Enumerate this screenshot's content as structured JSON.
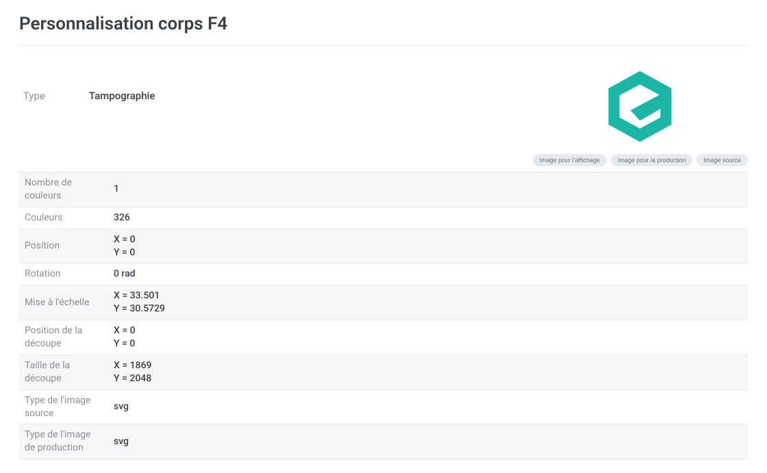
{
  "title": "Personnalisation corps F4",
  "top": {
    "type_label": "Type",
    "type_value": "Tampographie"
  },
  "pills": {
    "display": "Image pour l'affichage",
    "production": "Image pour la production",
    "source": "Image source"
  },
  "rows": [
    {
      "label": "Nombre de couleurs",
      "value": "1",
      "shade": true
    },
    {
      "label": "Couleurs",
      "value": "326",
      "shade": false
    },
    {
      "label": "Position",
      "lines": [
        "X = 0",
        "Y = 0"
      ],
      "shade": true
    },
    {
      "label": "Rotation",
      "value": "0 rad",
      "shade": false
    },
    {
      "label": "Mise à l'échelle",
      "lines": [
        "X = 33.501",
        "Y = 30.5729"
      ],
      "shade": true
    },
    {
      "label": "Position de la découpe",
      "lines": [
        "X = 0",
        "Y = 0"
      ],
      "shade": false
    },
    {
      "label": "Taille de la découpe",
      "lines": [
        "X = 1869",
        "Y = 2048"
      ],
      "shade": true
    },
    {
      "label": "Type de l'image source",
      "value": "svg",
      "shade": false
    },
    {
      "label": "Type de l'image de production",
      "value": "svg",
      "shade": true
    }
  ],
  "logo_color": "#1bb6a6"
}
